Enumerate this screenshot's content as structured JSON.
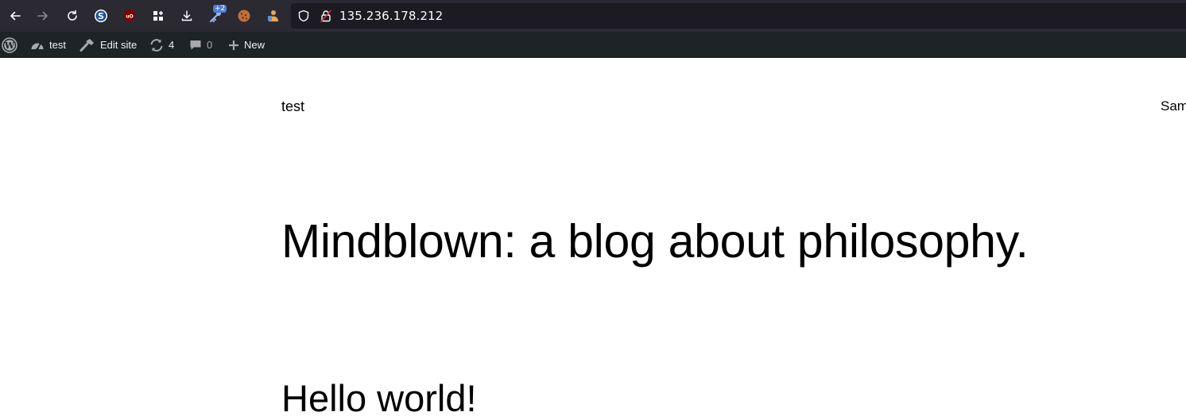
{
  "browser": {
    "url": "135.236.178.212",
    "extensions_badge": "+2",
    "icons": [
      "back-icon",
      "forward-icon",
      "reload-icon",
      "s-extension-icon",
      "ublock-icon",
      "grid-extension-icon",
      "download-icon",
      "key-extension-icon",
      "cookie-extension-icon",
      "puzzle-person-icon",
      "shield-icon",
      "lock-icon"
    ]
  },
  "admin_bar": {
    "site_name": "test",
    "edit_site": "Edit site",
    "updates_count": "4",
    "comments_count": "0",
    "new_label": "New"
  },
  "page": {
    "site_title": "test",
    "nav_item": "Sam",
    "hero_title": "Mindblown: a blog about philosophy.",
    "post_title": "Hello world!"
  },
  "colors": {
    "browser_bg": "#2b2a33",
    "urlbar_bg": "#1c1b22",
    "admin_bar_bg": "#1d2327",
    "page_bg": "#ffffff"
  }
}
